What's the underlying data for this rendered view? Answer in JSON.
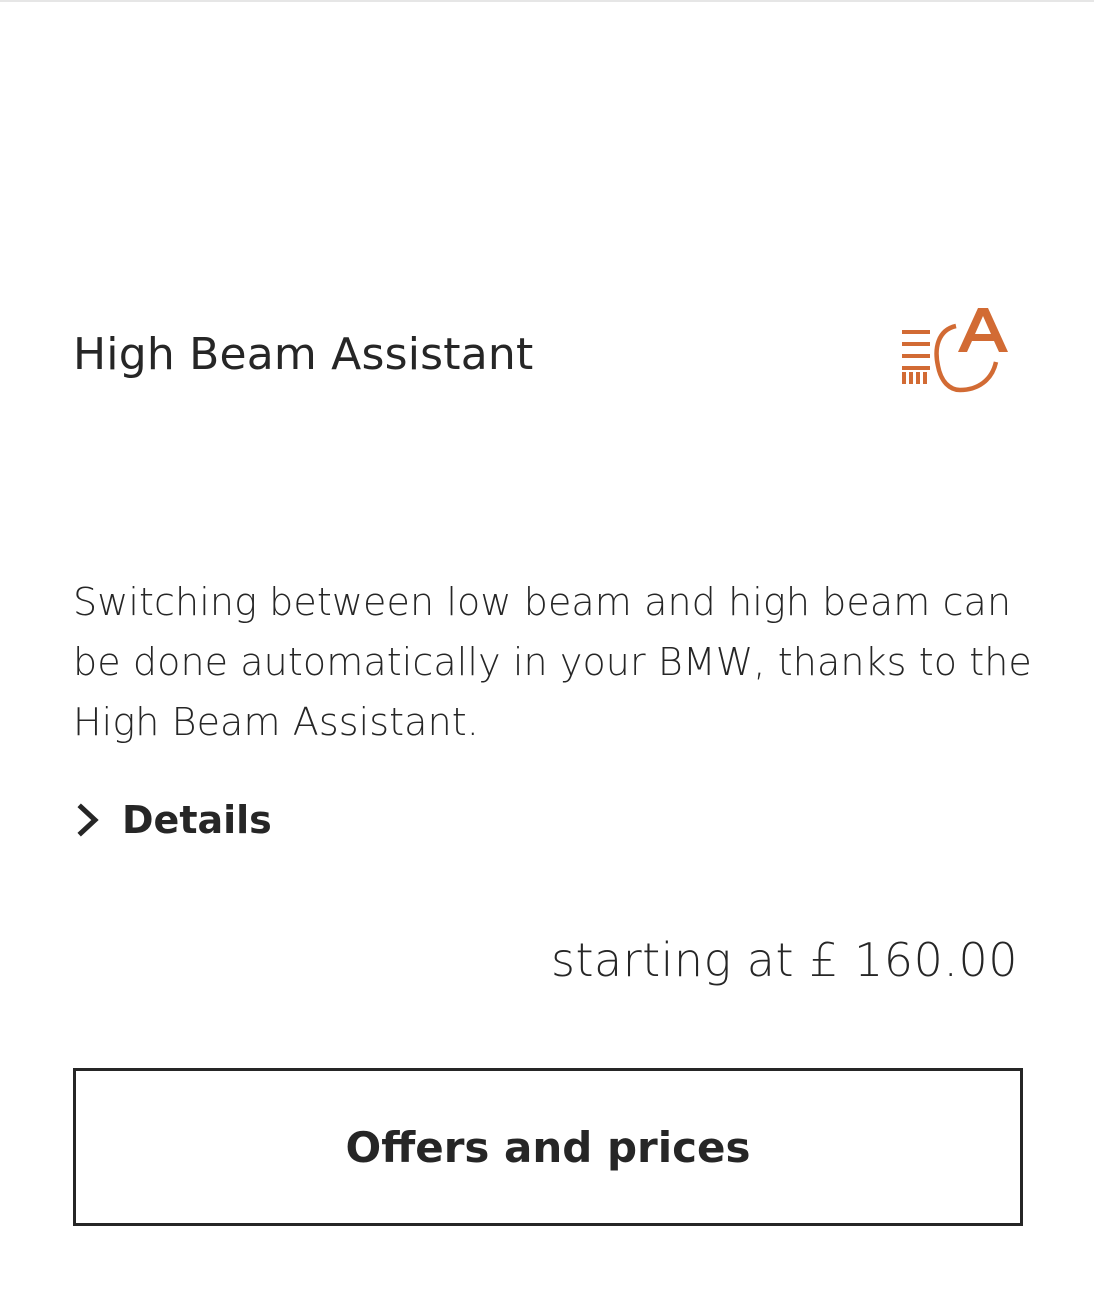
{
  "feature": {
    "title": "High Beam Assistant",
    "icon": "high-beam-assistant-icon",
    "description": "Switching between low beam and high beam can be done automatically in your BMW, thanks to the High Beam Assistant.",
    "details_label": "Details",
    "price_text": "starting at £ 160.00",
    "offers_button_label": "Offers and prices"
  },
  "colors": {
    "accent": "#d26b34",
    "text": "#262626",
    "border": "#262626",
    "background": "#ffffff"
  }
}
